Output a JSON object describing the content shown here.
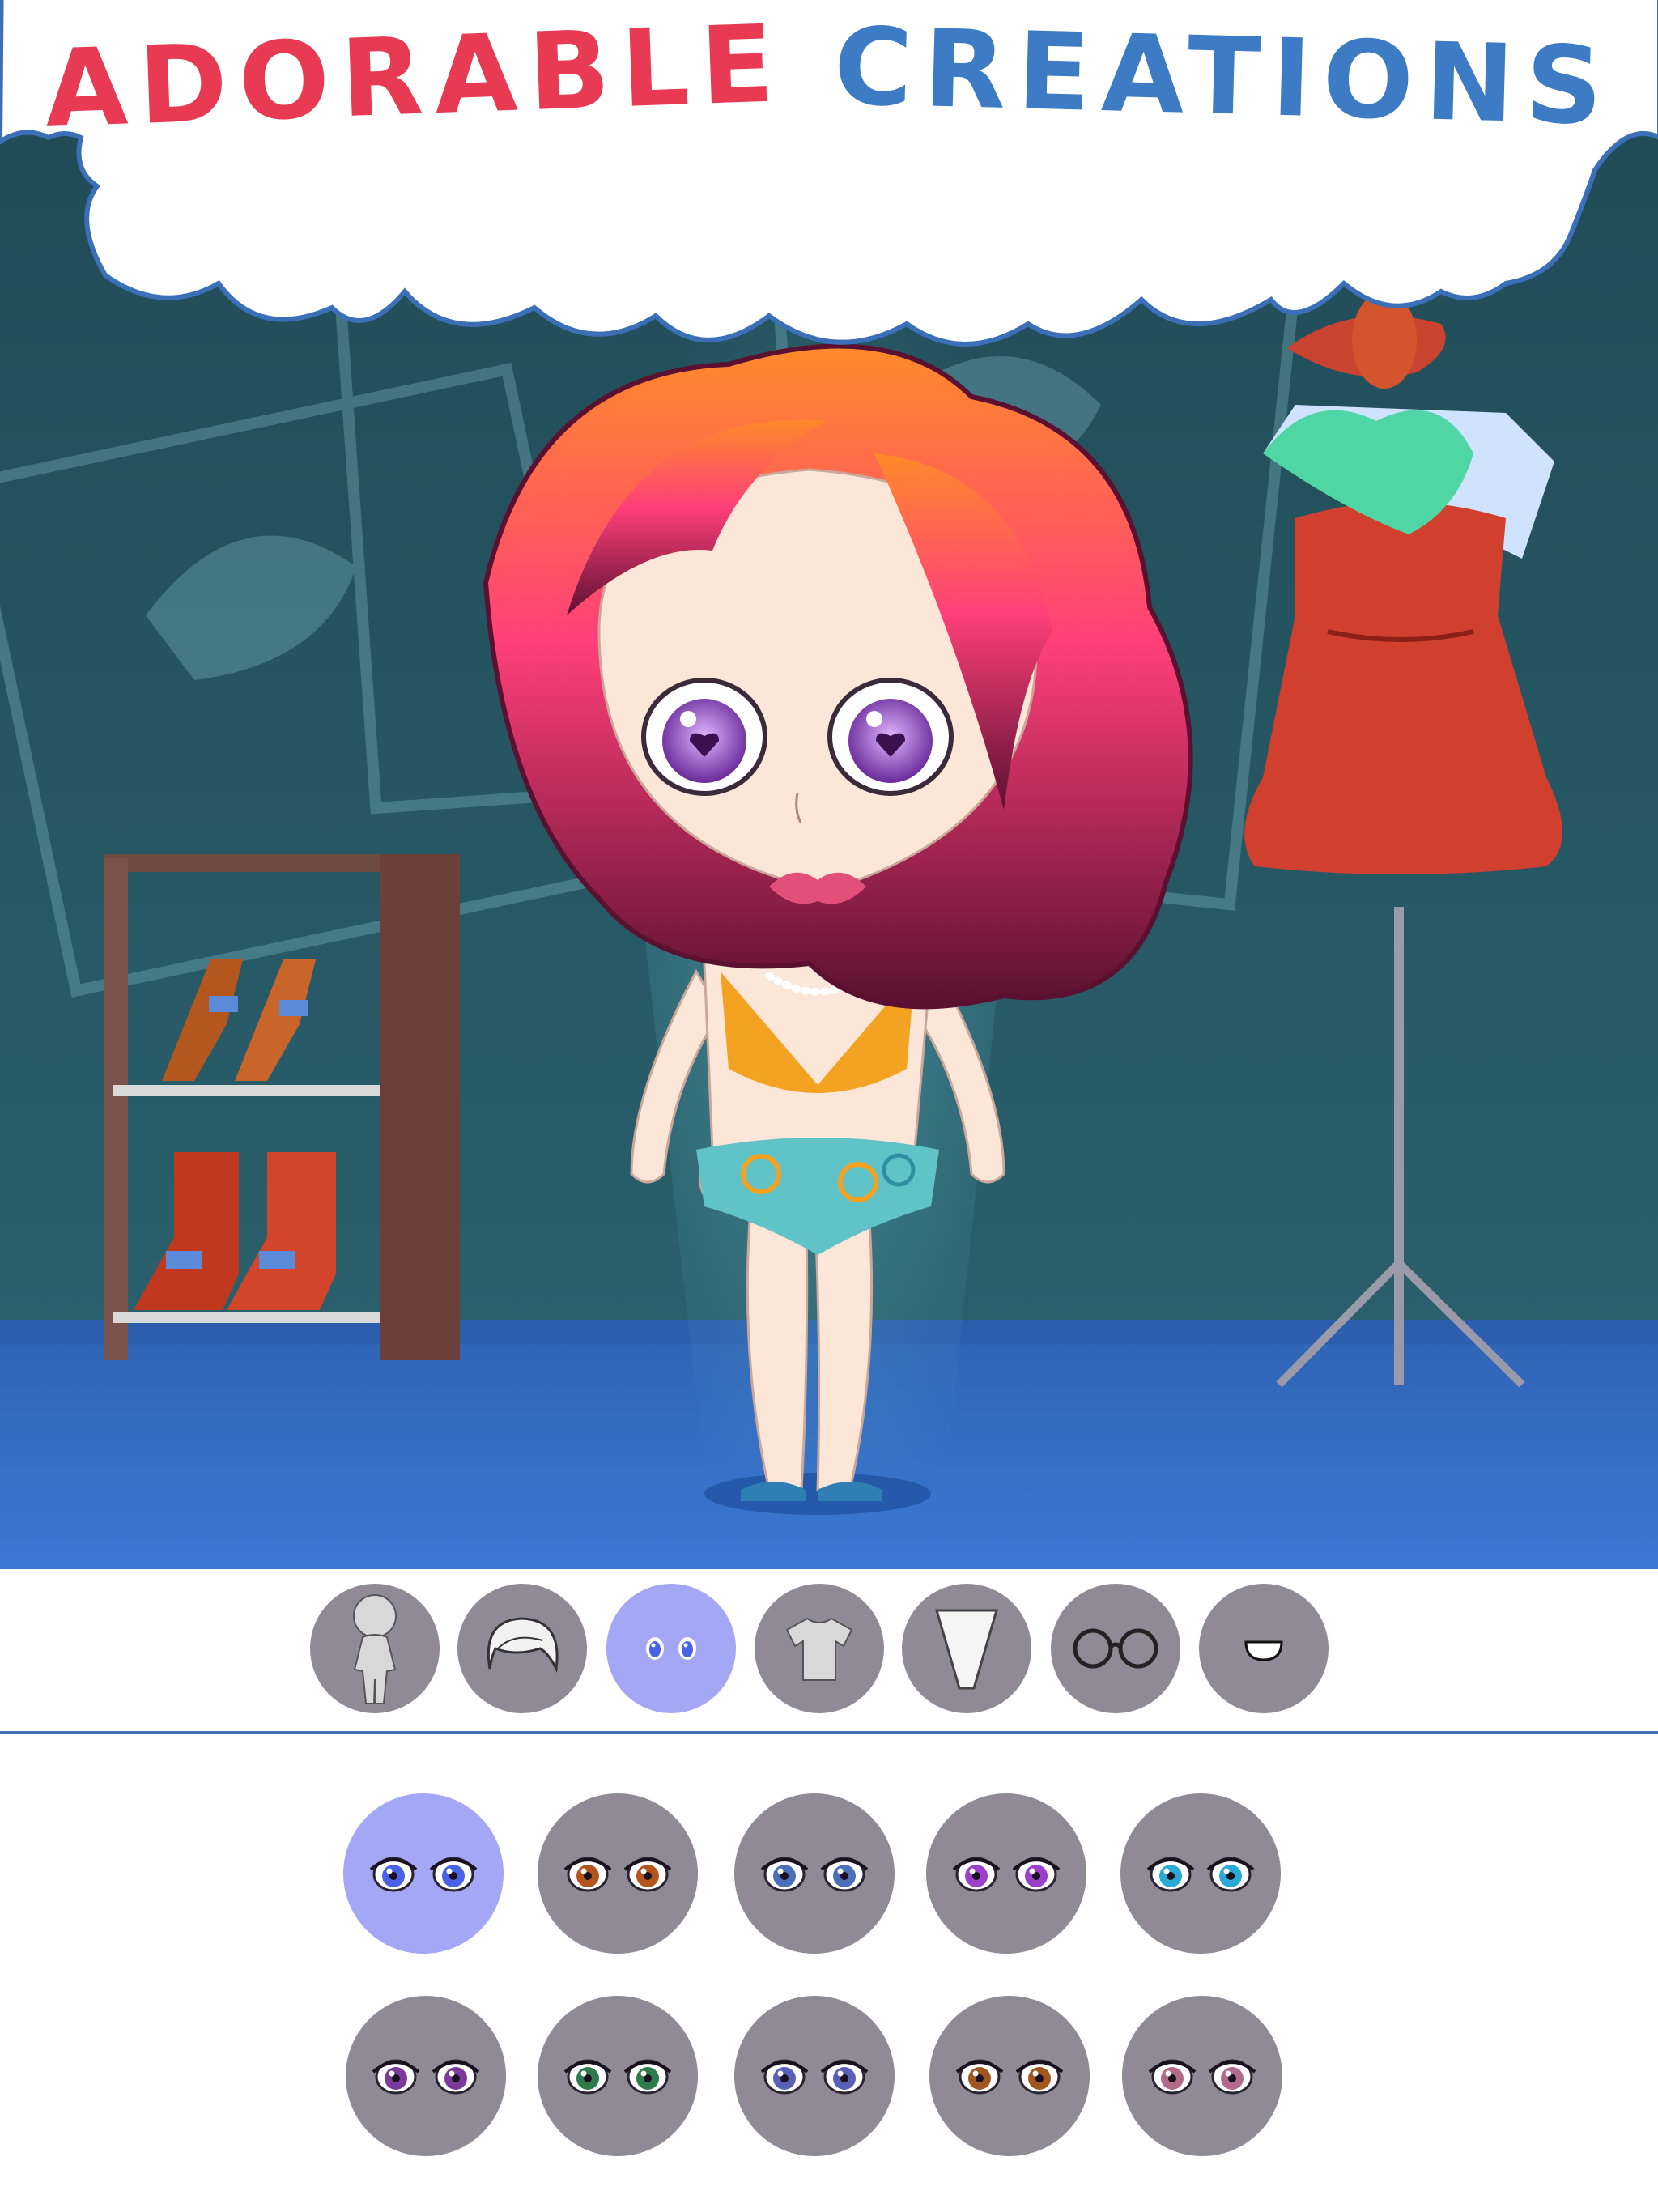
{
  "title": {
    "word1": "ADORABLE",
    "word2": "CREATIONS"
  },
  "colors": {
    "title_word1": "#e83a52",
    "title_word2": "#3d7bc4",
    "button_default": "#8f8a95",
    "button_selected": "#a4a7f5",
    "divider": "#3f6fb5"
  },
  "categories": [
    {
      "name": "body",
      "icon": "body-silhouette-icon",
      "selected": false
    },
    {
      "name": "hair",
      "icon": "hair-icon",
      "selected": false
    },
    {
      "name": "eyes",
      "icon": "eyes-icon",
      "selected": true
    },
    {
      "name": "top",
      "icon": "shirt-icon",
      "selected": false
    },
    {
      "name": "bottom",
      "icon": "skirt-icon",
      "selected": false
    },
    {
      "name": "glasses",
      "icon": "glasses-icon",
      "selected": false
    },
    {
      "name": "mouth",
      "icon": "mouth-icon",
      "selected": false
    }
  ],
  "eye_options": [
    {
      "iris": "#4a62e8",
      "selected": true
    },
    {
      "iris": "#b4541c",
      "selected": false
    },
    {
      "iris": "#4b6fb8",
      "selected": false
    },
    {
      "iris": "#9b3ec9",
      "selected": false
    },
    {
      "iris": "#2aa8d6",
      "selected": false
    },
    {
      "iris": "#7a3a9a",
      "selected": false
    },
    {
      "iris": "#2f7a4a",
      "selected": false
    },
    {
      "iris": "#5a5fb8",
      "selected": false
    },
    {
      "iris": "#a0561e",
      "selected": false
    },
    {
      "iris": "#b26a8a",
      "selected": false
    }
  ]
}
